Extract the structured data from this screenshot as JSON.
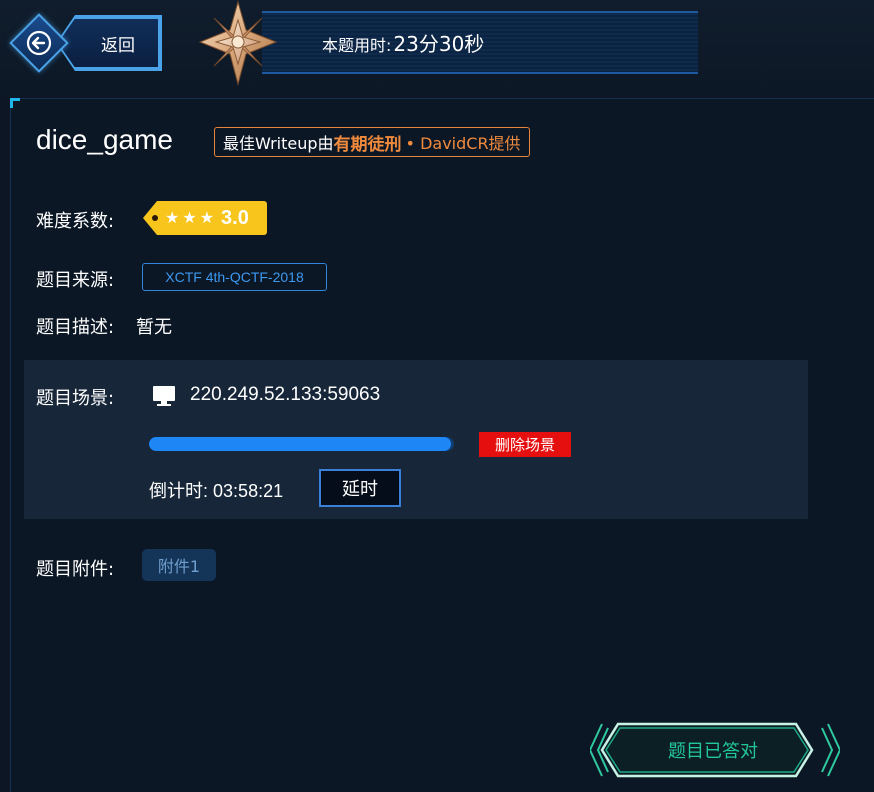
{
  "header": {
    "back_label": "返回",
    "timer_label": "本题用时:",
    "timer_value": "23分30秒"
  },
  "challenge": {
    "title": "dice_game",
    "writeup": {
      "prefix": "最佳Writeup由",
      "team": "有期徒刑",
      "suffix": "• DavidCR提供"
    },
    "difficulty": {
      "label": "难度系数:",
      "stars": 3,
      "score": "3.0"
    },
    "source": {
      "label": "题目来源:",
      "value": "XCTF 4th-QCTF-2018"
    },
    "description": {
      "label": "题目描述:",
      "value": "暂无"
    },
    "scene": {
      "label": "题目场景:",
      "address": "220.249.52.133:59063",
      "progress": 0.99,
      "delete_label": "删除场景",
      "countdown_label": "倒计时:",
      "countdown_value": "03:58:21",
      "extend_label": "延时"
    },
    "attachment": {
      "label": "题目附件:",
      "file_label": "附件1"
    },
    "solved_label": "题目已答对"
  },
  "colors": {
    "accent_blue": "#1e86f5",
    "writeup_orange": "#f08a3c",
    "difficulty_yellow": "#f7c51b",
    "danger_red": "#e50f0f",
    "solved_green": "#22c79a"
  }
}
